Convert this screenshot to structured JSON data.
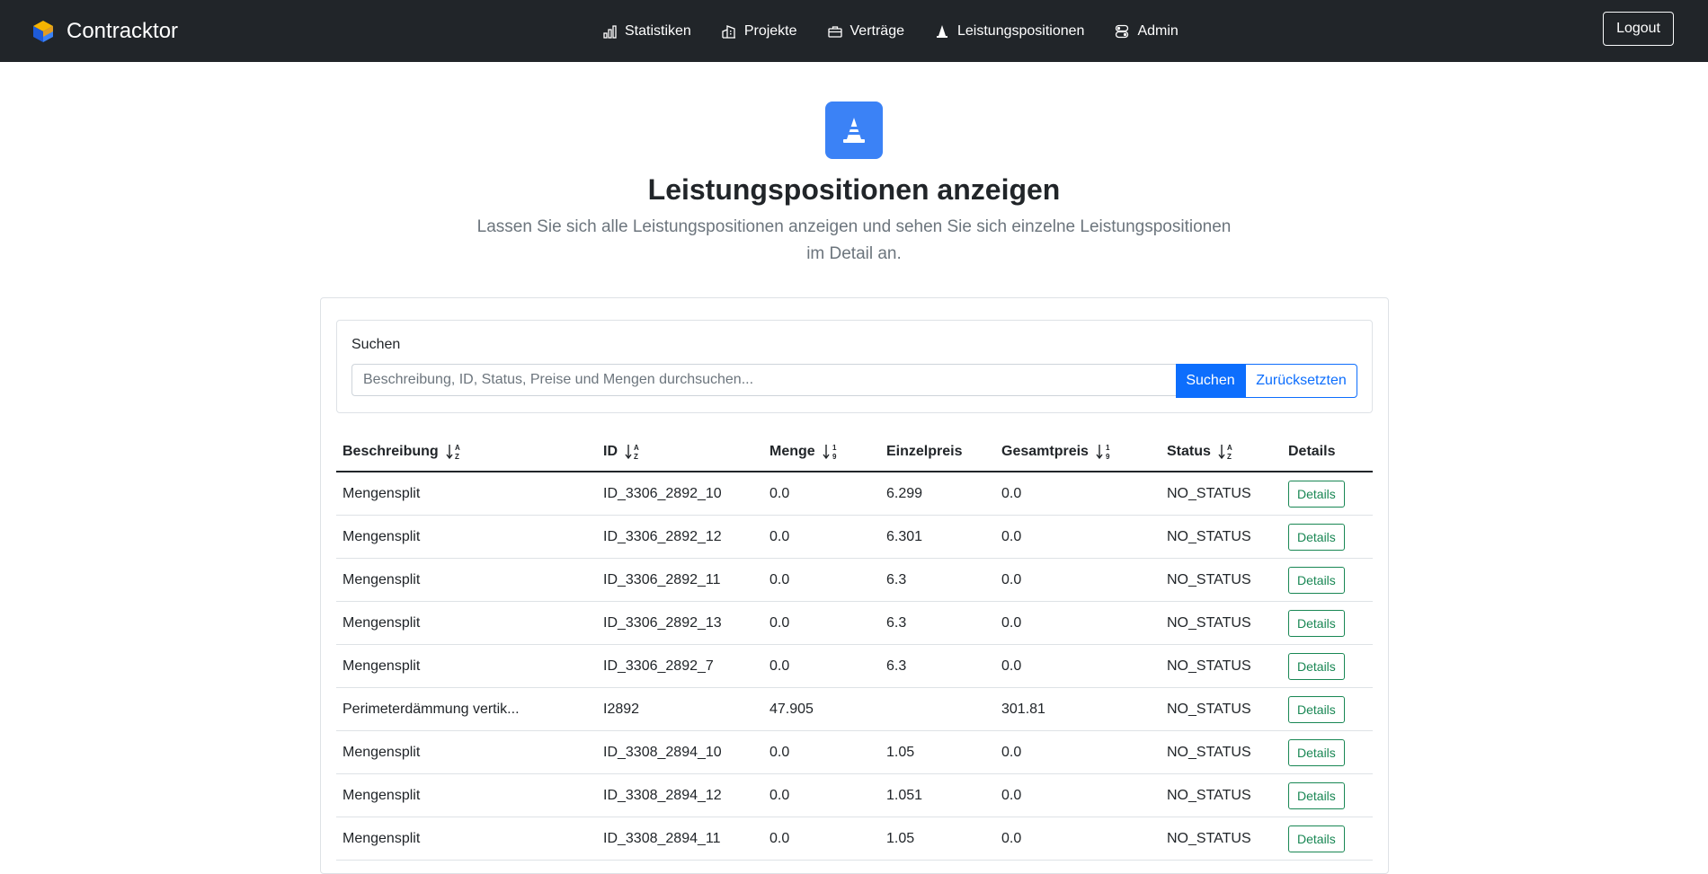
{
  "app": {
    "brand": "Contracktor"
  },
  "nav": {
    "items": [
      {
        "label": "Statistiken",
        "icon": "bar-chart-icon"
      },
      {
        "label": "Projekte",
        "icon": "buildings-icon"
      },
      {
        "label": "Verträge",
        "icon": "briefcase-icon"
      },
      {
        "label": "Leistungspositionen",
        "icon": "cone-icon"
      },
      {
        "label": "Admin",
        "icon": "toggles-icon"
      }
    ],
    "logout": "Logout"
  },
  "hero": {
    "title": "Leistungspositionen anzeigen",
    "subtitle": "Lassen Sie sich alle Leistungspositionen anzeigen und sehen Sie sich einzelne Leistungspositionen im Detail an."
  },
  "search": {
    "label": "Suchen",
    "placeholder": "Beschreibung, ID, Status, Preise und Mengen durchsuchen...",
    "submit": "Suchen",
    "reset": "Zurücksetzten"
  },
  "table": {
    "headers": {
      "beschreibung": "Beschreibung",
      "id": "ID",
      "menge": "Menge",
      "einzelpreis": "Einzelpreis",
      "gesamtpreis": "Gesamtpreis",
      "status": "Status",
      "details": "Details"
    },
    "details_label": "Details",
    "rows": [
      {
        "beschreibung": "Mengensplit",
        "id": "ID_3306_2892_10",
        "menge": "0.0",
        "einzelpreis": "6.299",
        "gesamtpreis": "0.0",
        "status": "NO_STATUS"
      },
      {
        "beschreibung": "Mengensplit",
        "id": "ID_3306_2892_12",
        "menge": "0.0",
        "einzelpreis": "6.301",
        "gesamtpreis": "0.0",
        "status": "NO_STATUS"
      },
      {
        "beschreibung": "Mengensplit",
        "id": "ID_3306_2892_11",
        "menge": "0.0",
        "einzelpreis": "6.3",
        "gesamtpreis": "0.0",
        "status": "NO_STATUS"
      },
      {
        "beschreibung": "Mengensplit",
        "id": "ID_3306_2892_13",
        "menge": "0.0",
        "einzelpreis": "6.3",
        "gesamtpreis": "0.0",
        "status": "NO_STATUS"
      },
      {
        "beschreibung": "Mengensplit",
        "id": "ID_3306_2892_7",
        "menge": "0.0",
        "einzelpreis": "6.3",
        "gesamtpreis": "0.0",
        "status": "NO_STATUS"
      },
      {
        "beschreibung": "Perimeterdämmung vertik...",
        "id": "I2892",
        "menge": "47.905",
        "einzelpreis": "",
        "gesamtpreis": "301.81",
        "status": "NO_STATUS"
      },
      {
        "beschreibung": "Mengensplit",
        "id": "ID_3308_2894_10",
        "menge": "0.0",
        "einzelpreis": "1.05",
        "gesamtpreis": "0.0",
        "status": "NO_STATUS"
      },
      {
        "beschreibung": "Mengensplit",
        "id": "ID_3308_2894_12",
        "menge": "0.0",
        "einzelpreis": "1.051",
        "gesamtpreis": "0.0",
        "status": "NO_STATUS"
      },
      {
        "beschreibung": "Mengensplit",
        "id": "ID_3308_2894_11",
        "menge": "0.0",
        "einzelpreis": "1.05",
        "gesamtpreis": "0.0",
        "status": "NO_STATUS"
      }
    ]
  }
}
